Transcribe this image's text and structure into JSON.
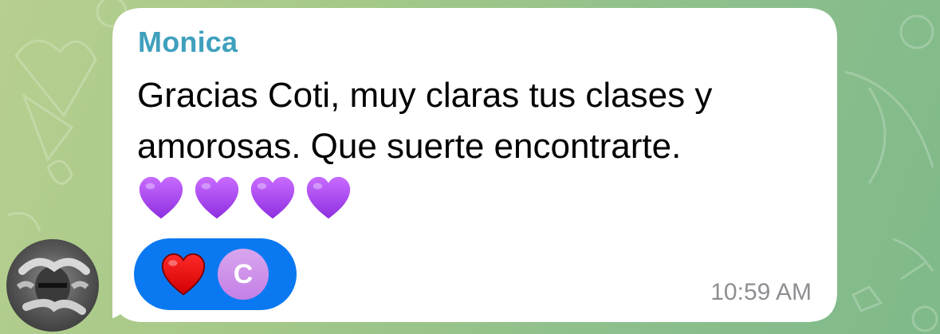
{
  "chat": {
    "background_color": "#9fc68a",
    "message": {
      "sender_name": "Monica",
      "sender_color": "#3fa0bd",
      "text": "Gracias Coti, muy claras tus clases y\namorosas. Que suerte encontrarte.",
      "emoji_hearts": [
        "purple-heart",
        "purple-heart",
        "purple-heart",
        "purple-heart"
      ],
      "timestamp": "10:59 AM",
      "reaction": {
        "emoji": "red-heart",
        "user_initial": "C",
        "pill_color": "#0a79f1",
        "user_color": "#c47fe6"
      }
    }
  }
}
